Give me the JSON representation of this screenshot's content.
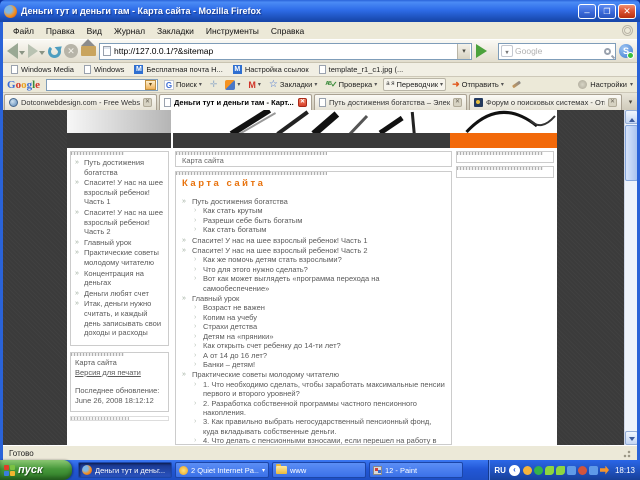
{
  "window": {
    "title": "Деньги тут и деньги там - Карта сайта - Mozilla Firefox"
  },
  "menu_bar": {
    "items": [
      "Файл",
      "Правка",
      "Вид",
      "Журнал",
      "Закладки",
      "Инструменты",
      "Справка"
    ]
  },
  "navigation": {
    "url": "http://127.0.0.1/?&sitemap",
    "search_placeholder": "Google"
  },
  "bookmarks_bar": {
    "items": [
      {
        "icon": "doc-icon",
        "label": "Windows Media"
      },
      {
        "icon": "doc-icon",
        "label": "Windows"
      },
      {
        "icon": "mail-icon",
        "label": "Бесплатная почта Н..."
      },
      {
        "icon": "mail-icon",
        "label": "Настройка ссылок"
      },
      {
        "icon": "doc-icon",
        "label": "template_r1_c1.jpg (..."
      }
    ]
  },
  "google_toolbar": {
    "logo": "Google",
    "buttons": [
      {
        "icon": "g-icon",
        "label": "Поиск",
        "arrow": true
      },
      {
        "icon": "crosshair-icon",
        "label": "",
        "arrow": false
      },
      {
        "icon": "fox-icon",
        "label": "",
        "arrow": true
      },
      {
        "icon": "gmail-icon",
        "label": "",
        "arrow": true
      },
      {
        "icon": "star-icon",
        "label": "Закладки",
        "arrow": true
      },
      {
        "icon": "spellcheck-icon",
        "label": "Проверка",
        "arrow": true
      },
      {
        "icon": "translate-icon",
        "label": "Переводчик",
        "arrow": true,
        "boxed": true
      },
      {
        "icon": "send-icon",
        "label": "Отправить",
        "arrow": true
      },
      {
        "icon": "pencil-icon",
        "label": "",
        "arrow": false
      }
    ],
    "settings_label": "Настройки"
  },
  "tabs": [
    {
      "favicon": "globe-favicon",
      "label": "Dotconwebdesign.com - Free Websit...",
      "active": false
    },
    {
      "favicon": "page-favicon",
      "label": "Деньги тут и деньги там - Карт...",
      "active": true
    },
    {
      "favicon": "page-favicon",
      "label": "Путь достижения богатства – Элек...",
      "active": false
    },
    {
      "favicon": "forum-favicon",
      "label": "Форум о поисковых системах - Отв...",
      "active": false
    }
  ],
  "page": {
    "breadcrumb": "Карта сайта",
    "sidebar": {
      "items": [
        "Путь достижения богатства",
        "Спасите! У нас на шее взрослый ребенок! Часть 1",
        "Спасите! У нас на шее взрослый ребенок! Часть 2",
        "Главный урок",
        "Практические советы молодому читателю",
        "Концентрация на деньгах",
        "Деньги любят счет",
        "Итак, деньги нужно считать, и каждый день записывать свои доходы и расходы"
      ],
      "info_box": {
        "line1": "Карта сайта",
        "print_link": "Версия для печати",
        "updated_label": "Последнее обновление:",
        "updated_value": "June 26, 2008 18:12:12"
      }
    },
    "main": {
      "title": "Карта сайта",
      "tree": [
        {
          "label": "Путь достижения богатства",
          "children": [
            "Как стать крутым",
            "Разреши себе быть богатым",
            "Как стать богатым"
          ]
        },
        {
          "label": "Спасите! У нас на шее взрослый ребенок! Часть 1",
          "children": []
        },
        {
          "label": "Спасите! У нас на шее взрослый ребенок! Часть 2",
          "children": [
            "Как же помочь детям стать взрослыми?",
            "Что для этого нужно сделать?",
            "Вот как может выглядеть «программа перехода на самообеспечение»"
          ]
        },
        {
          "label": "Главный урок",
          "children": [
            "Возраст не важен",
            "Копим на учебу",
            "Страхи детства",
            "Детям на «пряники»",
            "Как открыть счет ребенку до 14-ти лет?",
            "А от 14 до 16 лет?",
            "Банки – детям!"
          ]
        },
        {
          "label": "Практические советы молодому читателю",
          "children": [
            "1. Что необходимо сделать, чтобы заработать максимальные пенсии первого и второго уровней?",
            "2. Разработка собственной программы частного пенсионного накопления.",
            "3. Как правильно выбрать негосударственный пенсионный фонд, куда вкладывать собственные деньги.",
            "4. Что делать с пенсионными взносами, если перешел на работу в"
          ]
        }
      ]
    },
    "colors": {
      "accent_orange": "#f2690a",
      "title_orange": "#e8720c",
      "page_background": "#3b3b3b",
      "header_bar": "#3a3a3a"
    }
  },
  "status_bar": {
    "text": "Готово"
  },
  "taskbar": {
    "start_label": "пуск",
    "tasks": [
      {
        "icon": "firefox-icon",
        "label": "Деньги тут и деньг...",
        "active": true,
        "dropdown": false
      },
      {
        "icon": "qip-icon",
        "label": "2 Quiet Internet Pa...",
        "active": false,
        "dropdown": true
      },
      {
        "icon": "folder-icon",
        "label": "www",
        "active": false,
        "dropdown": false
      },
      {
        "icon": "paint-icon",
        "label": "12 - Paint",
        "active": false,
        "dropdown": false
      }
    ],
    "tray": {
      "language": "RU",
      "time": "18:13",
      "icons": [
        {
          "name": "messenger-tray-icon",
          "shape": "dot",
          "color": "#f5b43c"
        },
        {
          "name": "download-tray-icon",
          "shape": "dot",
          "color": "#35b44a"
        },
        {
          "name": "icq-flower-tray-icon",
          "shape": "flower",
          "color": "#8ed640"
        },
        {
          "name": "icq-flower2-tray-icon",
          "shape": "flower",
          "color": "#8ed640"
        },
        {
          "name": "network-tray-icon",
          "shape": "square",
          "color": "#5f9ae8"
        },
        {
          "name": "alert-tray-icon",
          "shape": "dot",
          "color": "#d2543c"
        },
        {
          "name": "network2-tray-icon",
          "shape": "square",
          "color": "#5f9ae8"
        },
        {
          "name": "update-tray-icon",
          "shape": "arrow",
          "color": "#f5952c"
        }
      ]
    }
  }
}
